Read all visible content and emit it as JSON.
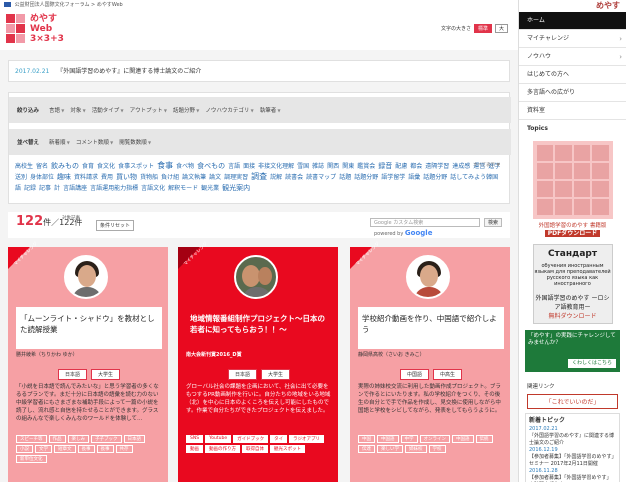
{
  "topbar": {
    "org": "公益財団法人国際文化フォーラム > めやすWeb"
  },
  "logo": {
    "line1": "めやす",
    "line2": "Web",
    "line3": "3×3+3"
  },
  "fontsize": {
    "label": "文字の大きさ",
    "large": "標準",
    "xlarge": "大"
  },
  "news": {
    "date": "2017.02.21",
    "text": "『外国語学習のめやす』に関連する博士論文のご紹介"
  },
  "filters": {
    "row1_label": "絞り込み",
    "row1_opts": [
      "言語",
      "対象",
      "活動タイプ",
      "アウトプット",
      "話題分野",
      "ノウハウカテゴリ",
      "執筆者"
    ],
    "row2_label": "並べ替え",
    "row2_opts": [
      "新着順",
      "コメント数順",
      "閲覧数数順"
    ],
    "more": "すべて表示 ▼",
    "tags": [
      {
        "t": "高校生",
        "s": ""
      },
      {
        "t": "留名",
        "s": ""
      },
      {
        "t": "飲みもの",
        "s": "mid"
      },
      {
        "t": "食育",
        "s": ""
      },
      {
        "t": "食文化",
        "s": ""
      },
      {
        "t": "食事スポット",
        "s": ""
      },
      {
        "t": "食事",
        "s": "big"
      },
      {
        "t": "食べ物",
        "s": ""
      },
      {
        "t": "食べもの",
        "s": "mid"
      },
      {
        "t": "言語",
        "s": ""
      },
      {
        "t": "面接",
        "s": ""
      },
      {
        "t": "非接文化理解",
        "s": ""
      },
      {
        "t": "雪国",
        "s": ""
      },
      {
        "t": "雑誌",
        "s": ""
      },
      {
        "t": "関西",
        "s": ""
      },
      {
        "t": "関東",
        "s": ""
      },
      {
        "t": "鑑賞会",
        "s": ""
      },
      {
        "t": "録音",
        "s": "mid"
      },
      {
        "t": "配慮",
        "s": ""
      },
      {
        "t": "都会",
        "s": ""
      },
      {
        "t": "遠隔学習",
        "s": ""
      },
      {
        "t": "達成感",
        "s": ""
      },
      {
        "t": "運営",
        "s": ""
      },
      {
        "t": "進学",
        "s": ""
      },
      {
        "t": "送別",
        "s": ""
      },
      {
        "t": "身体部位",
        "s": ""
      },
      {
        "t": "趣味",
        "s": "mid"
      },
      {
        "t": "資料請求",
        "s": ""
      },
      {
        "t": "費用",
        "s": ""
      },
      {
        "t": "買い物",
        "s": "mid"
      },
      {
        "t": "貨物船",
        "s": ""
      },
      {
        "t": "負け組",
        "s": ""
      },
      {
        "t": "論文執筆",
        "s": ""
      },
      {
        "t": "論文",
        "s": ""
      },
      {
        "t": "調理実習",
        "s": ""
      },
      {
        "t": "調査",
        "s": "big"
      },
      {
        "t": "説解",
        "s": ""
      },
      {
        "t": "読書会",
        "s": ""
      },
      {
        "t": "読書マップ",
        "s": ""
      },
      {
        "t": "話題",
        "s": ""
      },
      {
        "t": "話題分野",
        "s": ""
      },
      {
        "t": "語学留学",
        "s": ""
      },
      {
        "t": "語彙",
        "s": ""
      },
      {
        "t": "話題分野",
        "s": ""
      },
      {
        "t": "話してみよう韓国語",
        "s": ""
      },
      {
        "t": "記録",
        "s": ""
      },
      {
        "t": "記事",
        "s": ""
      },
      {
        "t": "計",
        "s": ""
      },
      {
        "t": "言語講座",
        "s": ""
      },
      {
        "t": "言語運用能力指標",
        "s": ""
      },
      {
        "t": "言語文化",
        "s": ""
      },
      {
        "t": "解釈モード",
        "s": ""
      },
      {
        "t": "観光業",
        "s": ""
      },
      {
        "t": "観光案内",
        "s": "mid"
      }
    ]
  },
  "count": {
    "num": "122",
    "unit": "件／122件",
    "label": "対象記事",
    "reset": "条件リセット"
  },
  "gsearch": {
    "placeholder": "カスタム検索",
    "google_prefix": "Google",
    "button": "検索",
    "powered": "powered by",
    "brand": "Google"
  },
  "cards": [
    {
      "ribbon": "マイチャレンジ",
      "title": "「ムーンライト・シャドウ」を教材とした読解授業",
      "author": "勝井綾希（ちりかわ ゆか）",
      "cats": [
        "日本語",
        "大学生"
      ],
      "desc": "「小説を日本語で読んでみたいな」と思う学習者の多くなるるプランです。まだ十分に日本語の語彙を読む力のない中級学習者にもさまざまな補助手段によって一篇の小説を読了し、流れ感と自信を持たせることができます。グラスの組みんなで楽しくみんなのワールドを体験して…",
      "tags": [
        "スピーチ等",
        "作品",
        "楽しみ",
        "子子ブック",
        "日本語",
        "小説",
        "文学",
        "短章文",
        "長事",
        "長事",
        "共存",
        "新単位文化"
      ]
    },
    {
      "ribbon": "マイチャレンジ",
      "title": "地域情報番組制作プロジェクト～日本の若者に知ってもらおう！！～",
      "author": "南大会新刊賞2016_D賞",
      "cats": [
        "日本語",
        "大学生"
      ],
      "desc": "グローバル社会の課題を企画において、社会に出て必要をもつするPR動画制作を行いに。自分たちの地域をいる地域（北）を中心に日本のよくころを伝えし可能にしたものです。作業で自分たちができたプロジェクトを伝えました。",
      "tags": [
        "SNS",
        "Youtube",
        "ガイドブック",
        "タイ",
        "ラジオアプリ",
        "動画",
        "動画の作り方",
        "取得自体",
        "観光スポット"
      ]
    },
    {
      "ribbon": "マイチャレンジ",
      "title": "学校紹介動画を作り、中国語で紹介しよう",
      "author": "静岡県高校（さいお きみこ）",
      "cats": [
        "中国語",
        "中高生"
      ],
      "desc": "実際の姉妹校交流に利用した動画作成プロジェクト。ブランで作るとにいたります。私の学校紹介をつくり、その後生の自分とで手で作品を作成し、見交換に使用しながら中国語と学校をシビしてながら、発表をしてもらうように。",
      "tags": [
        "中国",
        "中国語",
        "中学",
        "オンライン",
        "中国語",
        "伝統",
        "伝達",
        "楽しい学",
        "姉妹校",
        "学校"
      ]
    }
  ],
  "sidebar": {
    "logo": "めやす",
    "nav": [
      {
        "label": "ホーム",
        "dark": true
      },
      {
        "label": "マイチャレンジ",
        "dark": false
      },
      {
        "label": "ノウハウ",
        "dark": false
      },
      {
        "label": "はじめての方へ",
        "dark": false
      },
      {
        "label": "多言語への広がり",
        "dark": false
      },
      {
        "label": "資料室",
        "dark": false
      }
    ],
    "topics": "Topics",
    "poster_caption1": "外国語学習のめやす 書籍版",
    "poster_caption2": "PDFダウンロード",
    "ru_title": "Стандарт",
    "ru_sub": "обучения иностранным языкам для преподавателей русского языка как иностранного",
    "ru_jp": "外国語学習のめやす ーロシア語教育用ー",
    "ru_dl": "無料ダウンロード",
    "promo_text": "「めやす」の実践にチャレンジしてみませんか？",
    "promo_btn": "くわしくはこちら",
    "link_label": "関連リンク",
    "link2": "「これでいいのだ」",
    "news_head": "新着トピック",
    "news_items": [
      {
        "d": "2017.02.21",
        "t": "『外国語学習のめやす』に関連する博士論文のご紹介"
      },
      {
        "d": "2016.12.19",
        "t": "【参加者募集】「外国語学習のめやす」セミナー 2017年2月11日開催"
      },
      {
        "d": "2016.11.28",
        "t": "【参加者募集】「外国語学習めやす」実践研究報告会"
      }
    ]
  }
}
